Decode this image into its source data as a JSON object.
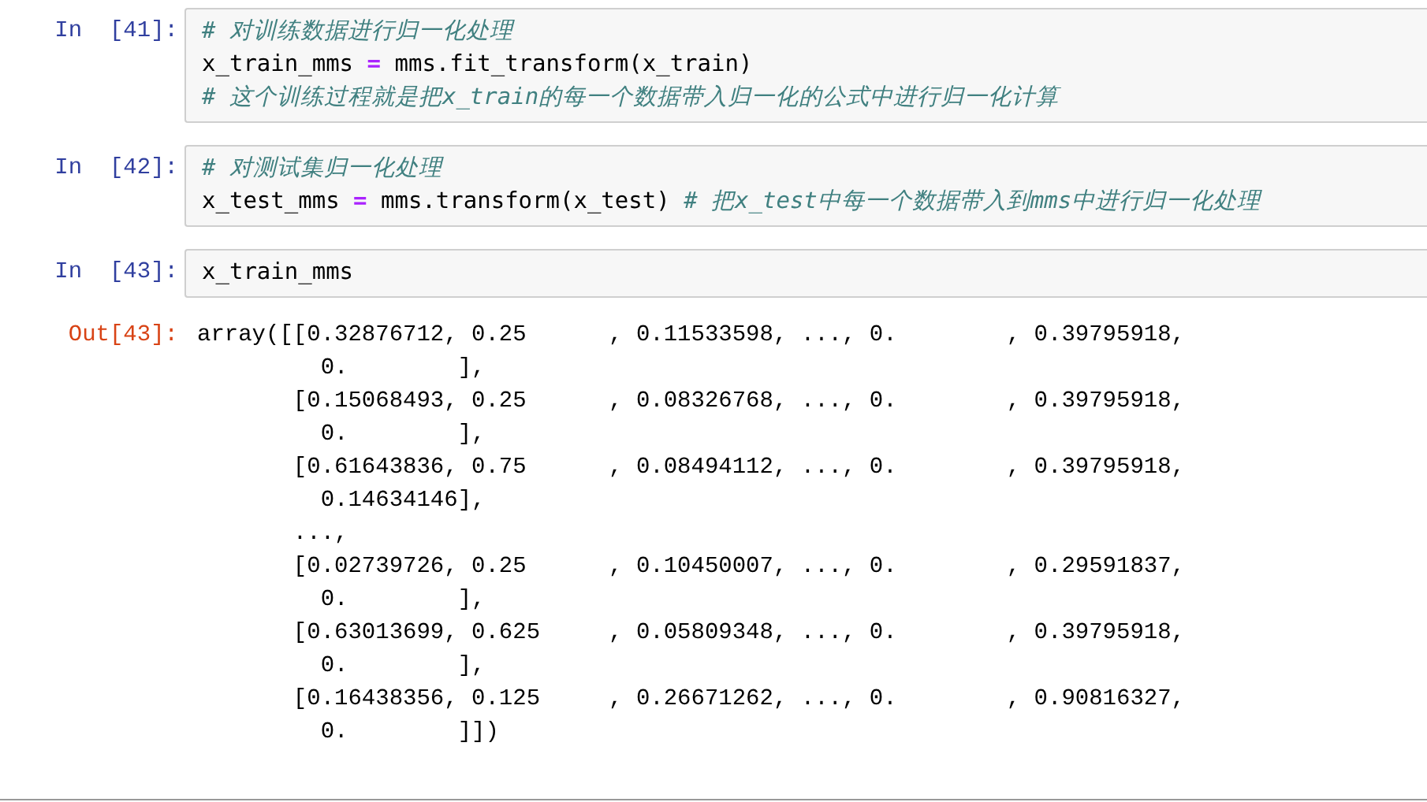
{
  "cells": [
    {
      "kind": "input",
      "prompt": "In  [41]:",
      "lines": [
        [
          {
            "kind": "comment",
            "text": "# 对训练数据进行归一化处理"
          }
        ],
        [
          {
            "kind": "code",
            "text": "x_train_mms "
          },
          {
            "kind": "operator",
            "text": "="
          },
          {
            "kind": "code",
            "text": " mms.fit_transform(x_train)"
          }
        ],
        [
          {
            "kind": "comment",
            "text": "# 这个训练过程就是把x_train的每一个数据带入归一化的公式中进行归一化计算"
          }
        ]
      ]
    },
    {
      "kind": "input",
      "prompt": "In  [42]:",
      "lines": [
        [
          {
            "kind": "comment",
            "text": "# 对测试集归一化处理"
          }
        ],
        [
          {
            "kind": "code",
            "text": "x_test_mms "
          },
          {
            "kind": "operator",
            "text": "="
          },
          {
            "kind": "code",
            "text": " mms.transform(x_test) "
          },
          {
            "kind": "comment",
            "text": "# 把x_test中每一个数据带入到mms中进行归一化处理"
          }
        ]
      ]
    },
    {
      "kind": "input",
      "prompt": "In  [43]:",
      "lines": [
        [
          {
            "kind": "code",
            "text": "x_train_mms"
          }
        ]
      ]
    },
    {
      "kind": "output",
      "prompt": "Out[43]:",
      "output_lines": [
        "array([[0.32876712, 0.25      , 0.11533598, ..., 0.        , 0.39795918,",
        "         0.        ],",
        "       [0.15068493, 0.25      , 0.08326768, ..., 0.        , 0.39795918,",
        "         0.        ],",
        "       [0.61643836, 0.75      , 0.08494112, ..., 0.        , 0.39795918,",
        "         0.14634146],",
        "       ...,",
        "       [0.02739726, 0.25      , 0.10450007, ..., 0.        , 0.29591837,",
        "         0.        ],",
        "       [0.63013699, 0.625     , 0.05809348, ..., 0.        , 0.39795918,",
        "         0.        ],",
        "       [0.16438356, 0.125     , 0.26671262, ..., 0.        , 0.90816327,",
        "         0.        ]])"
      ]
    }
  ]
}
